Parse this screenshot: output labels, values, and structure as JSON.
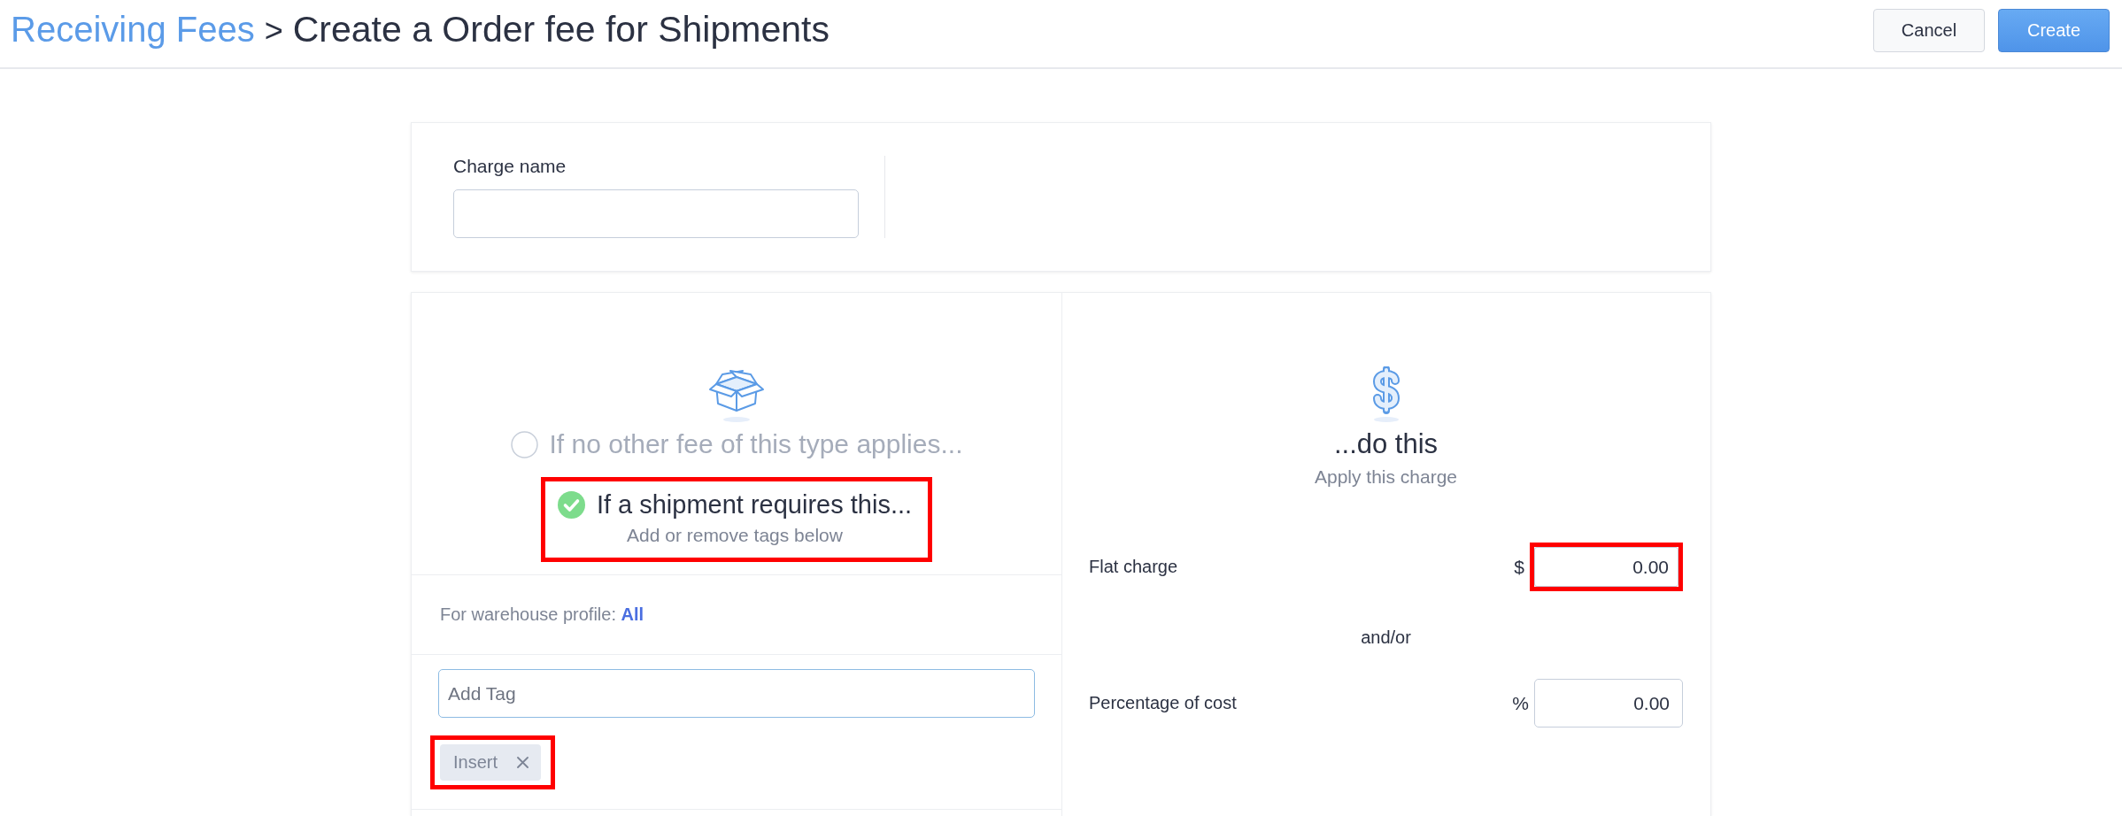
{
  "header": {
    "breadcrumb": {
      "parent": "Receiving Fees",
      "separator": ">",
      "current": "Create a Order fee for Shipments"
    },
    "buttons": [
      {
        "label": "Cancel",
        "kind": "secondary"
      },
      {
        "label": "Create",
        "kind": "primary"
      }
    ]
  },
  "charge_name": {
    "label": "Charge name"
  },
  "conditions": {
    "options": [
      {
        "label": "If no other fee of this type applies...",
        "selected": false,
        "highlighted": false
      },
      {
        "label": "If a shipment requires this...",
        "hint": "Add or remove tags below",
        "selected": true,
        "highlighted": true
      }
    ],
    "warehouse_profile": {
      "label": "For warehouse profile:",
      "value": "All"
    },
    "tag_input": {
      "placeholder": "Add Tag"
    },
    "tags": [
      {
        "label": "Insert",
        "highlighted": true
      }
    ]
  },
  "action": {
    "title": "...do this",
    "subtitle": "Apply this charge",
    "fields": [
      {
        "label": "Flat charge",
        "unit": "$",
        "value": "0.00",
        "highlighted": true
      },
      {
        "label": "Percentage of cost",
        "unit": "%",
        "value": "0.00",
        "highlighted": false
      }
    ],
    "separator": "and/or"
  }
}
